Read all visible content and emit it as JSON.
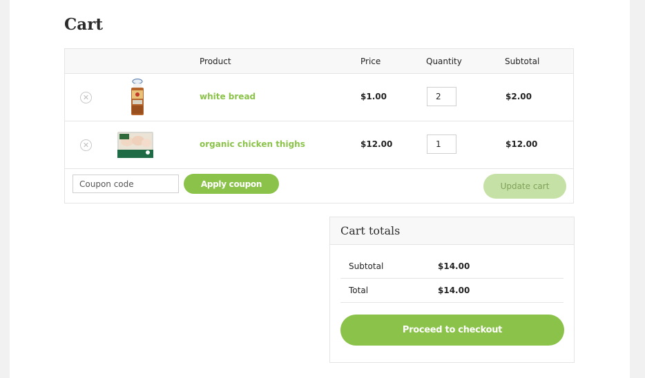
{
  "page": {
    "title": "Cart"
  },
  "cart_table": {
    "headers": {
      "product": "Product",
      "price": "Price",
      "quantity": "Quantity",
      "subtotal": "Subtotal"
    },
    "remove_icon": "close-icon",
    "items": [
      {
        "name": "white bread",
        "price": "$1.00",
        "quantity": "2",
        "subtotal": "$2.00",
        "thumbnail": "white-bread-image"
      },
      {
        "name": "organic chicken thighs",
        "price": "$12.00",
        "quantity": "1",
        "subtotal": "$12.00",
        "thumbnail": "chicken-thighs-image"
      }
    ]
  },
  "actions": {
    "coupon_placeholder": "Coupon code",
    "apply_coupon_label": "Apply coupon",
    "update_cart_label": "Update cart"
  },
  "cart_totals": {
    "title": "Cart totals",
    "subtotal_label": "Subtotal",
    "subtotal_value": "$14.00",
    "total_label": "Total",
    "total_value": "$14.00",
    "checkout_label": "Proceed to checkout"
  },
  "colors": {
    "accent": "#8bc34a",
    "accent_disabled": "#c5e1a5",
    "border": "#e4e4e4",
    "header_bg": "#f8f8f8"
  }
}
